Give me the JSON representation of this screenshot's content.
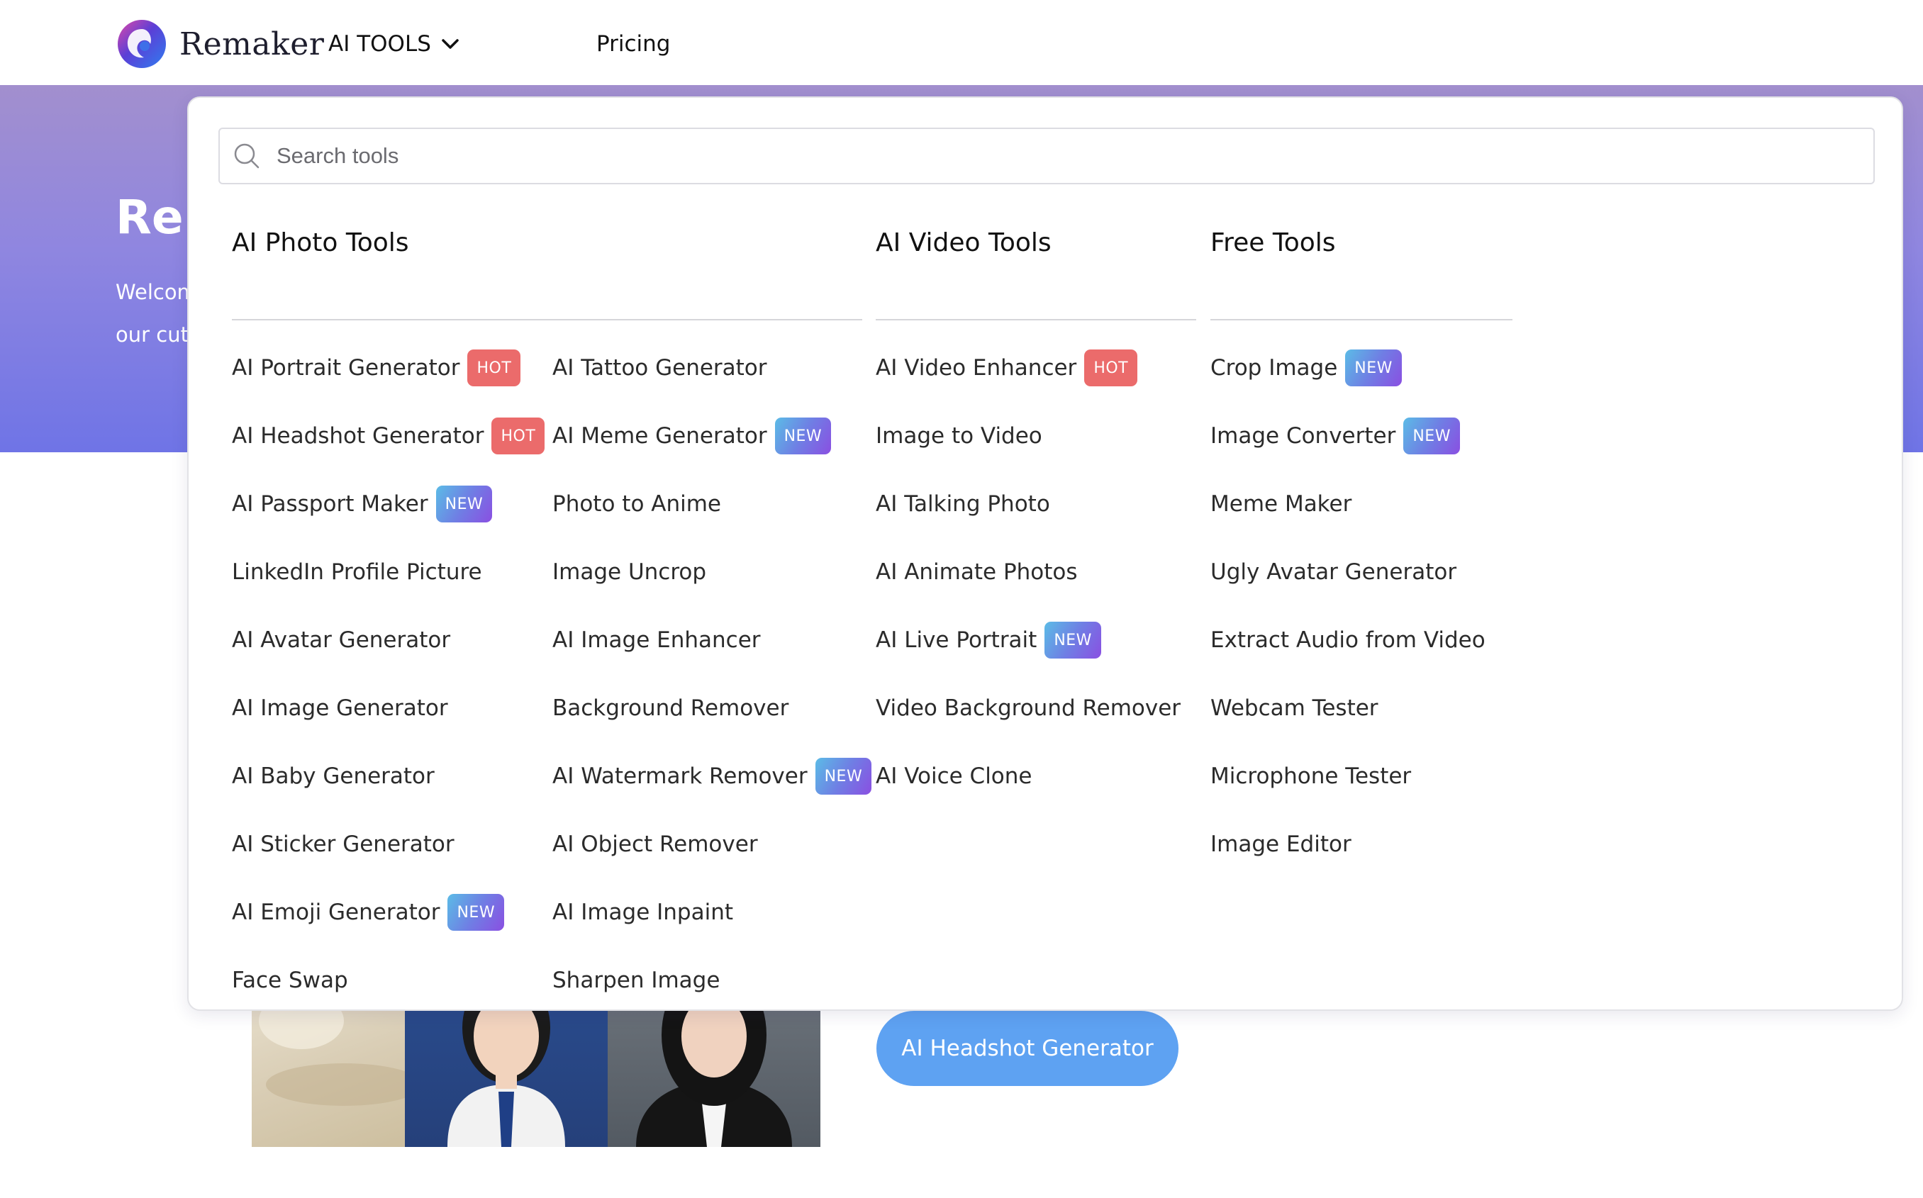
{
  "brand": {
    "name": "Remaker"
  },
  "nav": {
    "tools_label": "AI TOOLS",
    "pricing_label": "Pricing"
  },
  "hero": {
    "title_visible": "Rem",
    "subtitle_line1_visible": "Welcom",
    "subtitle_line2_visible": "our cut"
  },
  "search": {
    "placeholder": "Search tools",
    "value": ""
  },
  "sections": {
    "photo": {
      "title": "AI Photo Tools"
    },
    "video": {
      "title": "AI Video Tools"
    },
    "free": {
      "title": "Free Tools"
    }
  },
  "photo_col1": [
    {
      "label": "AI Portrait Generator",
      "badge": "HOT"
    },
    {
      "label": "AI Headshot Generator",
      "badge": "HOT"
    },
    {
      "label": "AI Passport Maker",
      "badge": "NEW"
    },
    {
      "label": "LinkedIn Profile Picture",
      "badge": ""
    },
    {
      "label": "AI Avatar Generator",
      "badge": ""
    },
    {
      "label": "AI Image Generator",
      "badge": ""
    },
    {
      "label": "AI Baby Generator",
      "badge": ""
    },
    {
      "label": "AI Sticker Generator",
      "badge": ""
    },
    {
      "label": "AI Emoji Generator",
      "badge": "NEW"
    },
    {
      "label": "Face Swap",
      "badge": ""
    }
  ],
  "photo_col2": [
    {
      "label": "AI Tattoo Generator",
      "badge": ""
    },
    {
      "label": "AI Meme Generator",
      "badge": "NEW"
    },
    {
      "label": "Photo to Anime",
      "badge": ""
    },
    {
      "label": "Image Uncrop",
      "badge": ""
    },
    {
      "label": "AI Image Enhancer",
      "badge": ""
    },
    {
      "label": "Background Remover",
      "badge": ""
    },
    {
      "label": "AI Watermark Remover",
      "badge": "NEW"
    },
    {
      "label": "AI Object Remover",
      "badge": ""
    },
    {
      "label": "AI Image Inpaint",
      "badge": ""
    },
    {
      "label": "Sharpen Image",
      "badge": ""
    }
  ],
  "video_col": [
    {
      "label": "AI Video Enhancer",
      "badge": "HOT"
    },
    {
      "label": "Image to Video",
      "badge": ""
    },
    {
      "label": "AI Talking Photo",
      "badge": ""
    },
    {
      "label": "AI Animate Photos",
      "badge": ""
    },
    {
      "label": "AI Live Portrait",
      "badge": "NEW"
    },
    {
      "label": "Video Background Remover",
      "badge": ""
    },
    {
      "label": "AI Voice Clone",
      "badge": ""
    }
  ],
  "free_col": [
    {
      "label": "Crop Image",
      "badge": "NEW"
    },
    {
      "label": "Image Converter",
      "badge": "NEW"
    },
    {
      "label": "Meme Maker",
      "badge": ""
    },
    {
      "label": "Ugly Avatar Generator",
      "badge": ""
    },
    {
      "label": "Extract Audio from Video",
      "badge": ""
    },
    {
      "label": "Webcam Tester",
      "badge": ""
    },
    {
      "label": "Microphone Tester",
      "badge": ""
    },
    {
      "label": "Image Editor",
      "badge": ""
    }
  ],
  "cta": {
    "label": "AI Headshot Generator"
  },
  "colors": {
    "hot_badge": "#eb6b6b",
    "new_badge_gradient": [
      "#5bbce6",
      "#6f7fe4",
      "#8a4fe2"
    ],
    "hero_gradient": [
      "#a28fce",
      "#6f74e6"
    ],
    "cta_button": "#5ea2f2"
  },
  "icons": {
    "search": "search-icon",
    "chevron": "chevron-down-icon",
    "logo": "remaker-logo"
  }
}
